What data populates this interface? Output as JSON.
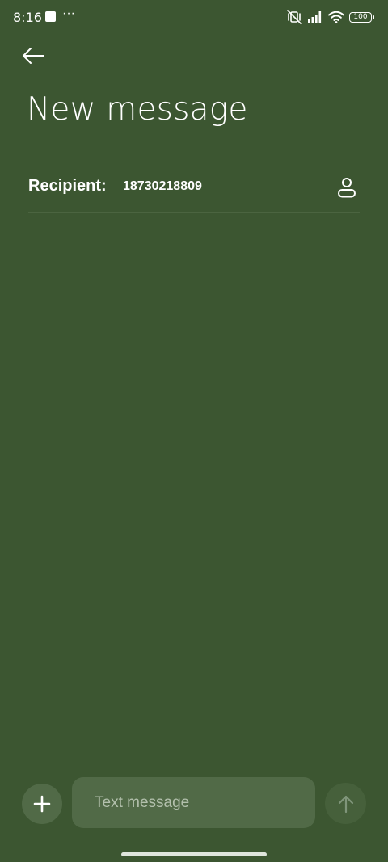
{
  "status_bar": {
    "time": "8:16",
    "more_indicator": "···",
    "battery_level": "100",
    "icons": [
      "notification-square-icon",
      "mute-vibrate-icon",
      "signal-icon",
      "wifi-icon",
      "battery-icon"
    ]
  },
  "header": {
    "back_icon": "arrow-left-icon",
    "title": "New message"
  },
  "recipient": {
    "label": "Recipient:",
    "value": "18730218809",
    "contact_icon": "person-icon"
  },
  "composer": {
    "add_icon": "plus-icon",
    "placeholder": "Text message",
    "value": "",
    "send_icon": "arrow-up-icon"
  },
  "colors": {
    "background": "#3c5631",
    "surface": "#516a47",
    "send_disabled": "#46603b",
    "text": "#ffffff",
    "placeholder": "#b3c0ad"
  }
}
